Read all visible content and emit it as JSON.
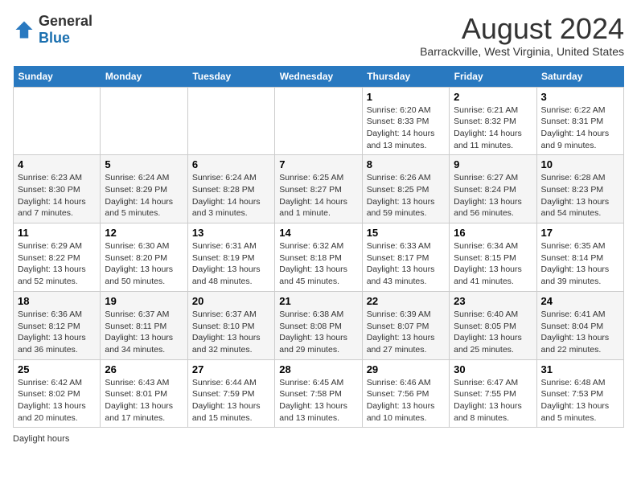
{
  "logo": {
    "general": "General",
    "blue": "Blue"
  },
  "title": "August 2024",
  "subtitle": "Barrackville, West Virginia, United States",
  "headers": [
    "Sunday",
    "Monday",
    "Tuesday",
    "Wednesday",
    "Thursday",
    "Friday",
    "Saturday"
  ],
  "footer": "Daylight hours",
  "weeks": [
    [
      {
        "day": "",
        "content": ""
      },
      {
        "day": "",
        "content": ""
      },
      {
        "day": "",
        "content": ""
      },
      {
        "day": "",
        "content": ""
      },
      {
        "day": "1",
        "content": "Sunrise: 6:20 AM\nSunset: 8:33 PM\nDaylight: 14 hours and 13 minutes."
      },
      {
        "day": "2",
        "content": "Sunrise: 6:21 AM\nSunset: 8:32 PM\nDaylight: 14 hours and 11 minutes."
      },
      {
        "day": "3",
        "content": "Sunrise: 6:22 AM\nSunset: 8:31 PM\nDaylight: 14 hours and 9 minutes."
      }
    ],
    [
      {
        "day": "4",
        "content": "Sunrise: 6:23 AM\nSunset: 8:30 PM\nDaylight: 14 hours and 7 minutes."
      },
      {
        "day": "5",
        "content": "Sunrise: 6:24 AM\nSunset: 8:29 PM\nDaylight: 14 hours and 5 minutes."
      },
      {
        "day": "6",
        "content": "Sunrise: 6:24 AM\nSunset: 8:28 PM\nDaylight: 14 hours and 3 minutes."
      },
      {
        "day": "7",
        "content": "Sunrise: 6:25 AM\nSunset: 8:27 PM\nDaylight: 14 hours and 1 minute."
      },
      {
        "day": "8",
        "content": "Sunrise: 6:26 AM\nSunset: 8:25 PM\nDaylight: 13 hours and 59 minutes."
      },
      {
        "day": "9",
        "content": "Sunrise: 6:27 AM\nSunset: 8:24 PM\nDaylight: 13 hours and 56 minutes."
      },
      {
        "day": "10",
        "content": "Sunrise: 6:28 AM\nSunset: 8:23 PM\nDaylight: 13 hours and 54 minutes."
      }
    ],
    [
      {
        "day": "11",
        "content": "Sunrise: 6:29 AM\nSunset: 8:22 PM\nDaylight: 13 hours and 52 minutes."
      },
      {
        "day": "12",
        "content": "Sunrise: 6:30 AM\nSunset: 8:20 PM\nDaylight: 13 hours and 50 minutes."
      },
      {
        "day": "13",
        "content": "Sunrise: 6:31 AM\nSunset: 8:19 PM\nDaylight: 13 hours and 48 minutes."
      },
      {
        "day": "14",
        "content": "Sunrise: 6:32 AM\nSunset: 8:18 PM\nDaylight: 13 hours and 45 minutes."
      },
      {
        "day": "15",
        "content": "Sunrise: 6:33 AM\nSunset: 8:17 PM\nDaylight: 13 hours and 43 minutes."
      },
      {
        "day": "16",
        "content": "Sunrise: 6:34 AM\nSunset: 8:15 PM\nDaylight: 13 hours and 41 minutes."
      },
      {
        "day": "17",
        "content": "Sunrise: 6:35 AM\nSunset: 8:14 PM\nDaylight: 13 hours and 39 minutes."
      }
    ],
    [
      {
        "day": "18",
        "content": "Sunrise: 6:36 AM\nSunset: 8:12 PM\nDaylight: 13 hours and 36 minutes."
      },
      {
        "day": "19",
        "content": "Sunrise: 6:37 AM\nSunset: 8:11 PM\nDaylight: 13 hours and 34 minutes."
      },
      {
        "day": "20",
        "content": "Sunrise: 6:37 AM\nSunset: 8:10 PM\nDaylight: 13 hours and 32 minutes."
      },
      {
        "day": "21",
        "content": "Sunrise: 6:38 AM\nSunset: 8:08 PM\nDaylight: 13 hours and 29 minutes."
      },
      {
        "day": "22",
        "content": "Sunrise: 6:39 AM\nSunset: 8:07 PM\nDaylight: 13 hours and 27 minutes."
      },
      {
        "day": "23",
        "content": "Sunrise: 6:40 AM\nSunset: 8:05 PM\nDaylight: 13 hours and 25 minutes."
      },
      {
        "day": "24",
        "content": "Sunrise: 6:41 AM\nSunset: 8:04 PM\nDaylight: 13 hours and 22 minutes."
      }
    ],
    [
      {
        "day": "25",
        "content": "Sunrise: 6:42 AM\nSunset: 8:02 PM\nDaylight: 13 hours and 20 minutes."
      },
      {
        "day": "26",
        "content": "Sunrise: 6:43 AM\nSunset: 8:01 PM\nDaylight: 13 hours and 17 minutes."
      },
      {
        "day": "27",
        "content": "Sunrise: 6:44 AM\nSunset: 7:59 PM\nDaylight: 13 hours and 15 minutes."
      },
      {
        "day": "28",
        "content": "Sunrise: 6:45 AM\nSunset: 7:58 PM\nDaylight: 13 hours and 13 minutes."
      },
      {
        "day": "29",
        "content": "Sunrise: 6:46 AM\nSunset: 7:56 PM\nDaylight: 13 hours and 10 minutes."
      },
      {
        "day": "30",
        "content": "Sunrise: 6:47 AM\nSunset: 7:55 PM\nDaylight: 13 hours and 8 minutes."
      },
      {
        "day": "31",
        "content": "Sunrise: 6:48 AM\nSunset: 7:53 PM\nDaylight: 13 hours and 5 minutes."
      }
    ]
  ]
}
